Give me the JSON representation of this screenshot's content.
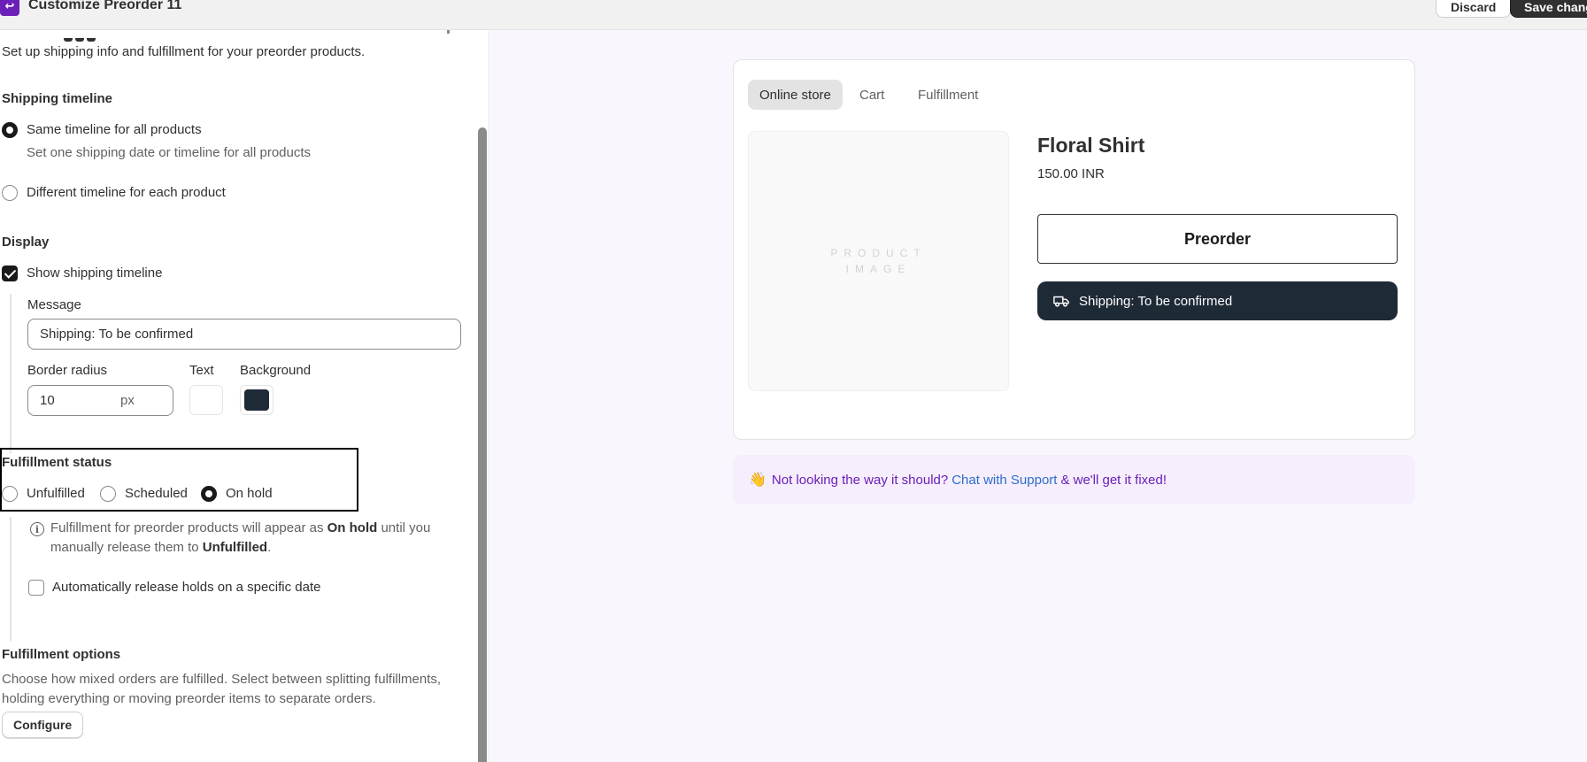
{
  "header": {
    "title": "Customize Preorder 11",
    "discard_label": "Discard",
    "save_label": "Save chang"
  },
  "shipping": {
    "subtitle": "Set up shipping info and fulfillment for your preorder products.",
    "timeline_heading": "Shipping timeline",
    "options": [
      {
        "label": "Same timeline for all products",
        "help": "Set one shipping date or timeline for all products",
        "selected": true
      },
      {
        "label": "Different timeline for each product",
        "selected": false
      }
    ]
  },
  "display": {
    "heading": "Display",
    "show_timeline_label": "Show shipping timeline",
    "show_timeline_checked": true,
    "message_label": "Message",
    "message_value": "Shipping: To be confirmed",
    "border_radius_label": "Border radius",
    "border_radius_value": "10",
    "border_radius_suffix": "px",
    "text_color_label": "Text",
    "background_color_label": "Background",
    "text_color": "#ffffff",
    "background_color": "#1f2a37"
  },
  "fulfillment_status": {
    "heading": "Fulfillment status",
    "options": [
      {
        "label": "Unfulfilled",
        "selected": false
      },
      {
        "label": "Scheduled",
        "selected": false
      },
      {
        "label": "On hold",
        "selected": true
      }
    ],
    "info_prefix": "Fulfillment for preorder products will appear as",
    "info_bold1": "On hold",
    "info_mid": "until you",
    "info_line2_prefix": "manually release them to",
    "info_bold2": "Unfulfilled",
    "info_suffix": ".",
    "auto_release_label": "Automatically release holds on a specific date",
    "auto_release_checked": false
  },
  "fulfillment_options": {
    "heading": "Fulfillment options",
    "description_line1": "Choose how mixed orders are fulfilled. Select between splitting fulfillments,",
    "description_line2": "holding everything or moving preorder items to separate orders.",
    "configure_label": "Configure"
  },
  "preview": {
    "tabs": [
      {
        "label": "Online store",
        "active": true
      },
      {
        "label": "Cart",
        "active": false
      },
      {
        "label": "Fulfillment",
        "active": false
      }
    ],
    "image_placeholder_line1": "PRODUCT",
    "image_placeholder_line2": "IMAGE",
    "product_title": "Floral Shirt",
    "product_price": "150.00 INR",
    "preorder_label": "Preorder",
    "shipping_badge": "Shipping: To be confirmed"
  },
  "support": {
    "emoji": "👋",
    "prefix": "Not looking the way it should?",
    "link": "Chat with Support",
    "suffix": "& we'll get it fixed!"
  },
  "colors": {
    "brand": "#6a1fb8",
    "link": "#2c6ecb",
    "badge_bg": "#1f2a37"
  }
}
